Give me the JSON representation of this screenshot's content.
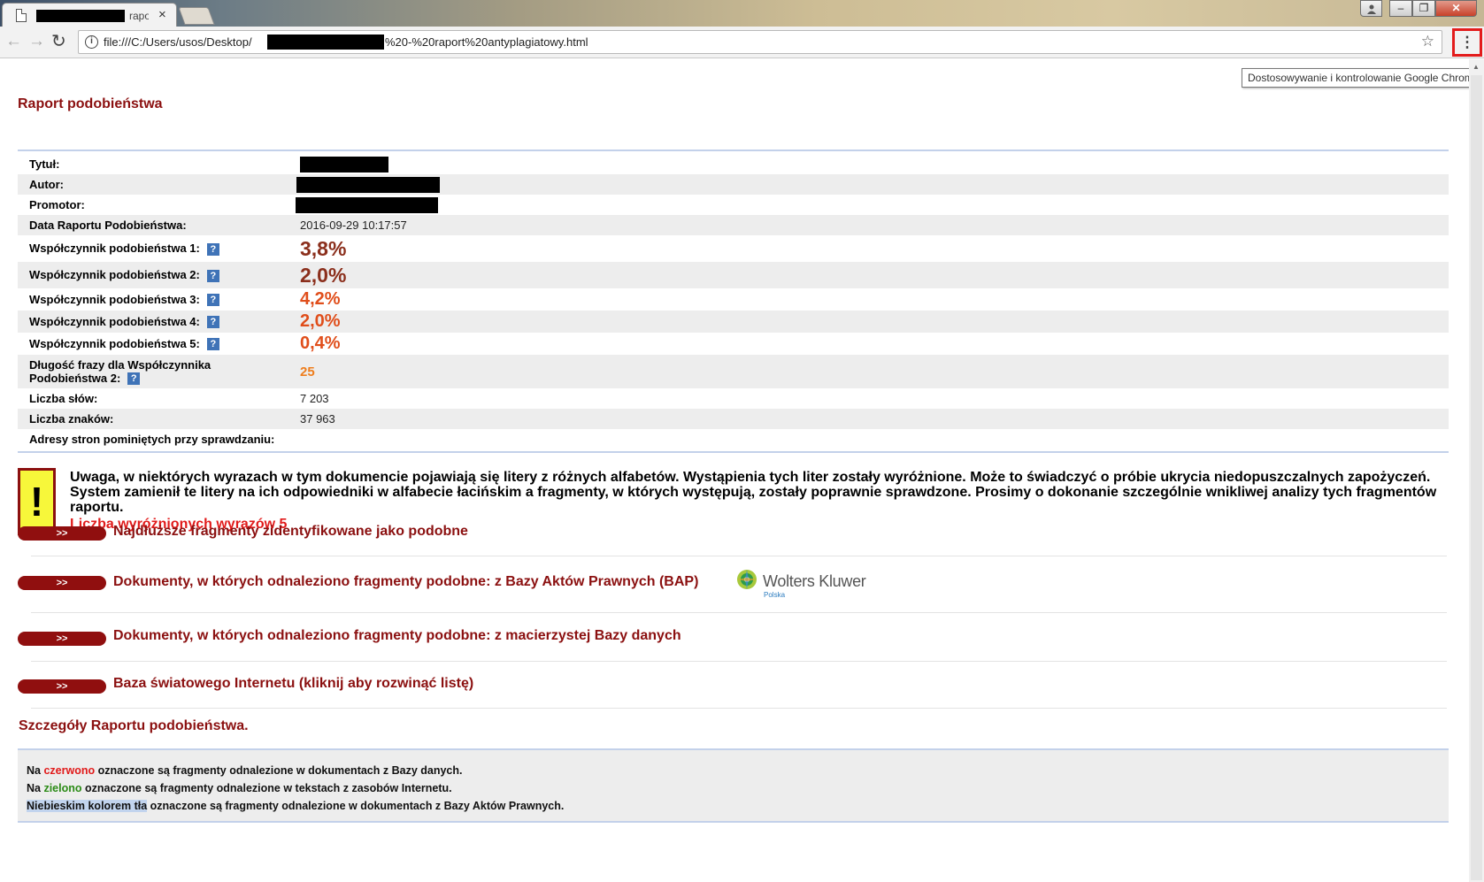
{
  "browser": {
    "tab": {
      "title": "rapo",
      "close": "×"
    },
    "url": {
      "prefix": "file:///C:/Users/usos/Desktop/",
      "suffix": "%20-%20raport%20antyplagiatowy.html"
    },
    "tooltip": "Dostosowywanie i kontrolowanie Google Chrome",
    "menu_glyph": "⋮"
  },
  "page": {
    "title": "Raport podobieństwa",
    "meta": {
      "title_label": "Tytuł:",
      "author_label": "Autor:",
      "promoter_label": "Promotor:",
      "date_label": "Data Raportu Podobieństwa:",
      "date_value": "2016-09-29 10:17:57",
      "coef1_label": "Współczynnik podobieństwa 1:",
      "coef1_value": "3,8%",
      "coef2_label": "Współczynnik podobieństwa 2:",
      "coef2_value": "2,0%",
      "coef3_label": "Współczynnik podobieństwa 3:",
      "coef3_value": "4,2%",
      "coef4_label": "Współczynnik podobieństwa 4:",
      "coef4_value": "2,0%",
      "coef5_label": "Współczynnik podobieństwa 5:",
      "coef5_value": "0,4%",
      "phrase_label_1": "Długość frazy dla Współczynnika",
      "phrase_label_2": "Podobieństwa 2:",
      "phrase_value": "25",
      "words_label": "Liczba słów:",
      "words_value": "7 203",
      "chars_label": "Liczba znaków:",
      "chars_value": "37 963",
      "skipped_label": "Adresy stron pominiętych przy sprawdzaniu:",
      "help_glyph": "?"
    },
    "warning": {
      "glyph": "!",
      "text": "Uwaga, w niektórych wyrazach w tym dokumencie pojawiają się litery z różnych alfabetów. Wystąpienia tych liter zostały wyróżnione. Może to świadczyć o próbie ukrycia niedopuszczalnych zapożyczeń. System zamienił te litery na ich odpowiedniki w alfabecie łacińskim a fragmenty, w których występują, zostały poprawnie sprawdzone. Prosimy o dokonanie szczególnie wnikliwej analizy tych fragmentów raportu.",
      "count": "Liczba wyróżnionych wyrazów 5"
    },
    "sections": {
      "button_label": ">>",
      "s1": "Najdłuższe fragmenty zidentyfikowane jako podobne",
      "s2": "Dokumenty, w których odnaleziono fragmenty podobne: z Bazy Aktów Prawnych (BAP)",
      "s3": "Dokumenty, w których odnaleziono fragmenty podobne: z macierzystej Bazy danych",
      "s4": "Baza światowego Internetu (kliknij aby rozwinąć listę)"
    },
    "logo": {
      "name": "Wolters Kluwer",
      "sub": "Polska"
    },
    "details_title": "Szczegóły Raportu podobieństwa.",
    "legend": {
      "l1_pre": "Na ",
      "l1_color": "czerwono",
      "l1_post": " oznaczone są fragmenty odnalezione w dokumentach z Bazy danych.",
      "l2_pre": "Na ",
      "l2_color": "zielono",
      "l2_post": " oznaczone są fragmenty odnalezione w tekstach z zasobów Internetu.",
      "l3_color": "Niebieskim kolorem tła",
      "l3_post": " oznaczone są fragmenty odnalezione w dokumentach z Bazy Aktów Prawnych."
    }
  },
  "colors": {
    "heading": "#8b1010",
    "coef_dark": "#8b2f1c",
    "coef_red": "#e04e1b",
    "coef_orange": "#ee7e1e",
    "warning_bg": "#f7f73a",
    "highlight_red": "#e11b1b",
    "highlight_green": "#2b8b16",
    "highlight_blue_bg": "#c2d4ee",
    "menu_outline": "#e31c1c"
  }
}
